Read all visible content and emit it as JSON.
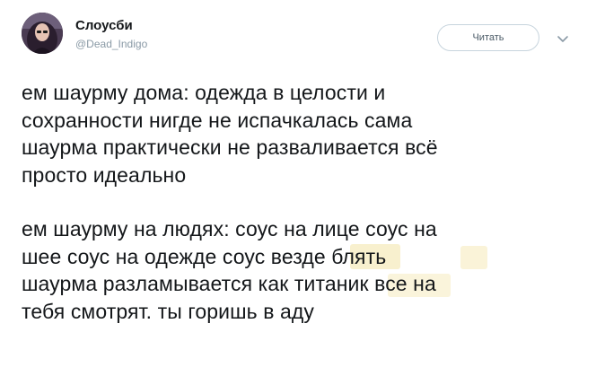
{
  "author": {
    "display_name": "Слоусби",
    "handle": "@Dead_Indigo",
    "avatar_icon": "profile-photo"
  },
  "follow_button": {
    "label": "Читать"
  },
  "menu": {
    "icon": "chevron-down-icon"
  },
  "tweet": {
    "paragraphs": [
      {
        "lines": [
          "ем шаурму дома: одежда в целости и",
          "сохранности нигде не испачкалась сама",
          "шаурма практически не разваливается всё",
          "просто идеально"
        ]
      },
      {
        "lines": [
          "ем шаурму на людях: соус на лице соус на",
          "шее соус на одежде соус везде блять",
          "шаурма разламывается как титаник все на",
          "тебя смотрят. ты горишь в аду"
        ]
      }
    ]
  },
  "colors": {
    "text": "#14171a",
    "muted": "#8a9aa6",
    "border": "#c7d4dd",
    "sauce_stain": "#f3e3a6"
  }
}
